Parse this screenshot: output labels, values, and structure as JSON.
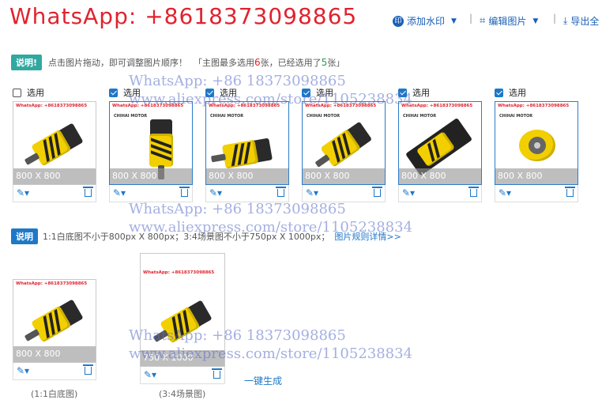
{
  "header": {
    "title": "WhatsApp: +8618373098865"
  },
  "toolbar": {
    "watermark_label": "添加水印",
    "edit_label": "编辑图片",
    "export_label": "导出全"
  },
  "info": {
    "badge": "说明!",
    "text1": "点击图片拖动，即可调整图片顺序！",
    "text2": "「主图最多选用",
    "max": "6",
    "text3": "张，已经选用了",
    "used": "5",
    "text4": "张」"
  },
  "cards": [
    {
      "check_label": "选用",
      "checked": false,
      "watermark": "WhatsApp: +8618373098865",
      "brand": "",
      "size": "800 X 800"
    },
    {
      "check_label": "选用",
      "checked": true,
      "watermark": "WhatsApp: +8618373098865",
      "brand": "CHIHAI MOTOR",
      "size": "800 X 800"
    },
    {
      "check_label": "选用",
      "checked": true,
      "watermark": "WhatsApp: +8618373098865",
      "brand": "CHIHAI MOTOR",
      "size": "800 X 800"
    },
    {
      "check_label": "选用",
      "checked": true,
      "watermark": "WhatsApp: +8618373098865",
      "brand": "CHIHAI MOTOR",
      "size": "800 X 800"
    },
    {
      "check_label": "选用",
      "checked": true,
      "watermark": "WhatsApp: +8618373098865",
      "brand": "CHIHAI MOTOR",
      "size": "800 X 800"
    },
    {
      "check_label": "选用",
      "checked": true,
      "watermark": "WhatsApp: +8618373098865",
      "brand": "CHIHAI MOTOR",
      "size": "800 X 800"
    }
  ],
  "note": {
    "badge": "说明",
    "text": "1:1白底图不小于800px X 800px；3:4场景图不小于750px X 1000px；",
    "link": "图片规则详情>>"
  },
  "bottom": {
    "white_size": "800 X 800",
    "white_caption": "(1:1白底图)",
    "scene_caption": "(3:4场景图)",
    "scene_size": "750 X 1000",
    "watermark": "WhatsApp: +8618373098865",
    "one_click": "一键生成"
  },
  "overlays": [
    "WhatsApp: +86 18373098865",
    "www.aliexpress.com/store/1105238834",
    "WhatsApp: +86 18373098865",
    "www.aliexpress.com/store/1105238834",
    "WhatsApp: +86 18373098865",
    "www.aliexpress.com/store/1105238834"
  ],
  "colors": {
    "accent": "#1e78c8",
    "brand_red": "#e0232f",
    "badge": "#31a8a0"
  }
}
